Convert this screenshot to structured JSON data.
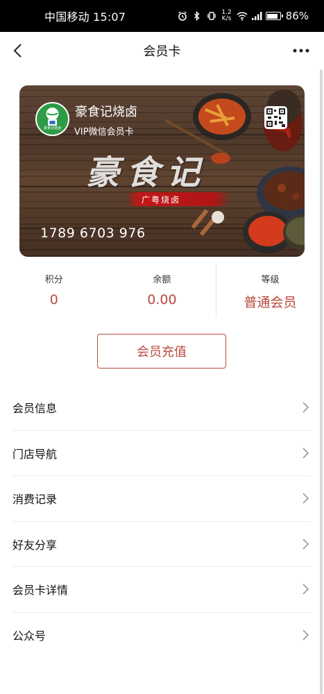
{
  "status_bar": {
    "carrier_time": "中国移动 15:07",
    "net_speed_value": "1.2",
    "net_speed_unit": "K/s",
    "battery_level": 0.86,
    "battery": "86%"
  },
  "nav": {
    "title": "会员卡"
  },
  "card": {
    "brand_name": "豪食记烧卤",
    "vip_label": "VIP微信会员卡",
    "logo_text": "豪食记烧卤",
    "big_brand": "豪食记",
    "ribbon_text": "广粤烧卤",
    "number": "1789 6703 976"
  },
  "stats": [
    {
      "label": "积分",
      "value": "0"
    },
    {
      "label": "余额",
      "value": "0.00"
    },
    {
      "label": "等级",
      "value": "普通会员"
    }
  ],
  "recharge_label": "会员充值",
  "menu": [
    {
      "label": "会员信息"
    },
    {
      "label": "门店导航"
    },
    {
      "label": "消费记录"
    },
    {
      "label": "好友分享"
    },
    {
      "label": "会员卡详情"
    },
    {
      "label": "公众号"
    }
  ],
  "colors": {
    "accent": "#b84a3c",
    "status_bar": "#000000"
  }
}
